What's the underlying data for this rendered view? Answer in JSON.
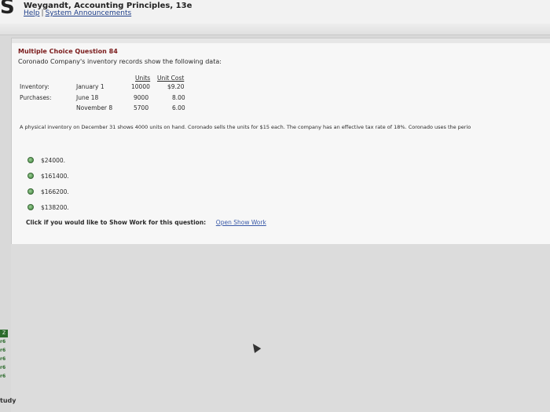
{
  "header": {
    "logo": "S",
    "book_title": "Weygandt, Accounting Principles, 13e",
    "help_link": "Help",
    "separator": "|",
    "announcements_link": "System Announcements"
  },
  "question": {
    "title": "Multiple Choice Question 84",
    "intro": "Coronado Company's inventory records show the following data:",
    "table": {
      "col_units": "Units",
      "col_cost": "Unit Cost",
      "rows": [
        {
          "label": "Inventory:",
          "date": "January 1",
          "units": "10000",
          "cost": "$9.20"
        },
        {
          "label": "Purchases:",
          "date": "June 18",
          "units": "9000",
          "cost": "8.00"
        },
        {
          "label": "",
          "date": "November 8",
          "units": "5700",
          "cost": "6.00"
        }
      ]
    },
    "text": "A physical inventory on December 31 shows 4000 units on hand. Coronado sells the units for $15 each. The company has an effective tax rate of 18%. Coronado uses the perio",
    "options": [
      "$24000.",
      "$161400.",
      "$166200.",
      "$138200."
    ],
    "show_work_label": "Click if you would like to Show Work for this question:",
    "show_work_link": "Open Show Work"
  },
  "sidebar": {
    "badge": "Z",
    "items": [
      "r6",
      "r6",
      "r6",
      "r6",
      "r6"
    ],
    "study_label": "tudy"
  },
  "colors": {
    "title_red": "#7a1a1a",
    "link_blue": "#3a5aa8",
    "radio_green": "#5f9f5b"
  }
}
